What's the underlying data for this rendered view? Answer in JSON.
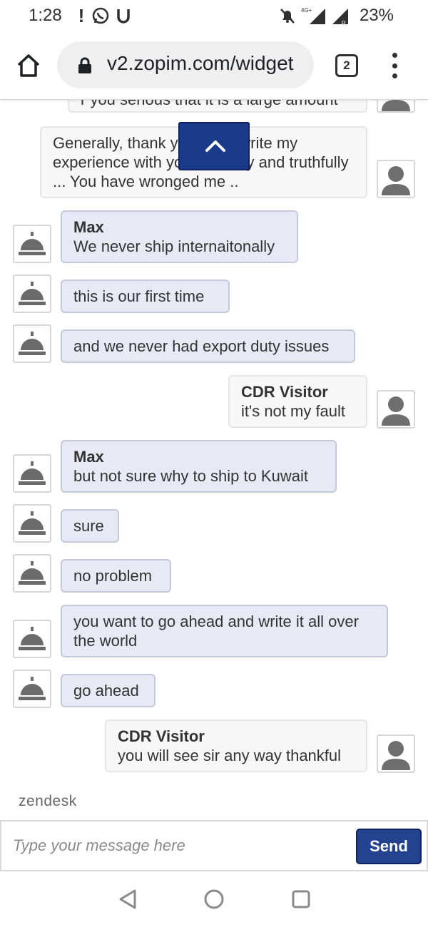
{
  "status_bar": {
    "time": "1:28",
    "network_label": "4G+",
    "battery": "23%"
  },
  "browser": {
    "url": "v2.zopim.com/widget",
    "tab_count": "2"
  },
  "chat": {
    "partial_top_message": "r you serious that it is a large amount",
    "messages": [
      {
        "sender": "visitor",
        "name": "",
        "text": "Generally, thank you, I will write my experience with you honestly and truthfully ... You have wronged me .."
      },
      {
        "sender": "agent",
        "name": "Max",
        "text": "We never ship internaitonally"
      },
      {
        "sender": "agent",
        "name": "",
        "text": "this is our first time"
      },
      {
        "sender": "agent",
        "name": "",
        "text": "and we never had export duty issues"
      },
      {
        "sender": "visitor",
        "name": "CDR Visitor",
        "text": "it's not my fault"
      },
      {
        "sender": "agent",
        "name": "Max",
        "text": "but not sure why to ship to Kuwait"
      },
      {
        "sender": "agent",
        "name": "",
        "text": "sure"
      },
      {
        "sender": "agent",
        "name": "",
        "text": "no problem"
      },
      {
        "sender": "agent",
        "name": "",
        "text": "you want to go ahead and write it all over the world"
      },
      {
        "sender": "agent",
        "name": "",
        "text": "go ahead"
      },
      {
        "sender": "visitor",
        "name": "CDR Visitor",
        "text": "you will see sir any way thankful"
      }
    ]
  },
  "branding": {
    "label": "zendesk"
  },
  "composer": {
    "placeholder": "Type your message here",
    "send_label": "Send"
  },
  "colors": {
    "agent_bubble": "#e7eaf4",
    "visitor_bubble": "#f7f7f7",
    "send_button": "#23438f"
  }
}
